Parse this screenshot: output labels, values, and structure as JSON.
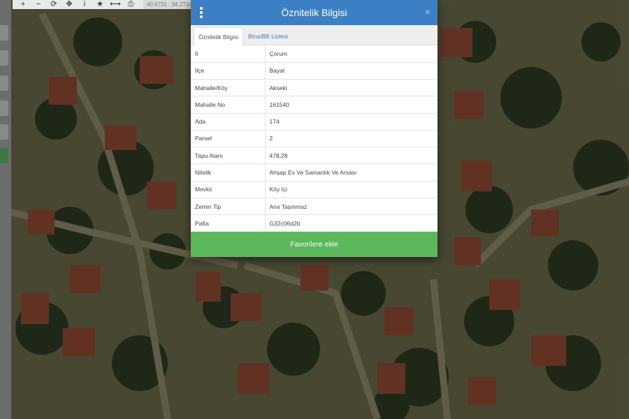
{
  "toolbar": {
    "tools": [
      {
        "icon": "zoom-in-icon",
        "glyph": "+"
      },
      {
        "icon": "zoom-out-icon",
        "glyph": "−"
      },
      {
        "icon": "refresh-icon",
        "glyph": "⟳"
      },
      {
        "icon": "locate-icon",
        "glyph": "✥"
      },
      {
        "icon": "info-icon",
        "glyph": "i"
      },
      {
        "icon": "star-icon",
        "glyph": "★"
      },
      {
        "icon": "measure-icon",
        "glyph": "⟷"
      },
      {
        "icon": "print-icon",
        "glyph": "⎙"
      }
    ],
    "coordinates": "40.6731 : 34.2724"
  },
  "modal": {
    "title": "Öznitelik Bilgisi",
    "close_glyph": "×",
    "tabs": [
      {
        "label": "Öznitelik Bilgisi",
        "active": true
      },
      {
        "label": "Bina/BB Listesi",
        "active": false
      }
    ],
    "rows": [
      {
        "key": "İl",
        "value": "Çorum"
      },
      {
        "key": "İlçe",
        "value": "Bayat"
      },
      {
        "key": "Mahalle/Köy",
        "value": "Akseki"
      },
      {
        "key": "Mahalle No",
        "value": "161540"
      },
      {
        "key": "Ada",
        "value": "174"
      },
      {
        "key": "Parsel",
        "value": "2"
      },
      {
        "key": "Tapu Alanı",
        "value": "478,28"
      },
      {
        "key": "Nitelik",
        "value": "Ahşap Ev Ve Samanlık Ve Arsası"
      },
      {
        "key": "Mevkii",
        "value": "Köy İçi"
      },
      {
        "key": "Zemin Tip",
        "value": "Ana Taşınmaz"
      },
      {
        "key": "Pafta",
        "value": "G32c06d2b"
      }
    ],
    "favorite_button": "Favorilere ekle"
  },
  "colors": {
    "header": "#3b7fc4",
    "favorite_button": "#5cb85c",
    "tab_link": "#3b7fc4"
  }
}
